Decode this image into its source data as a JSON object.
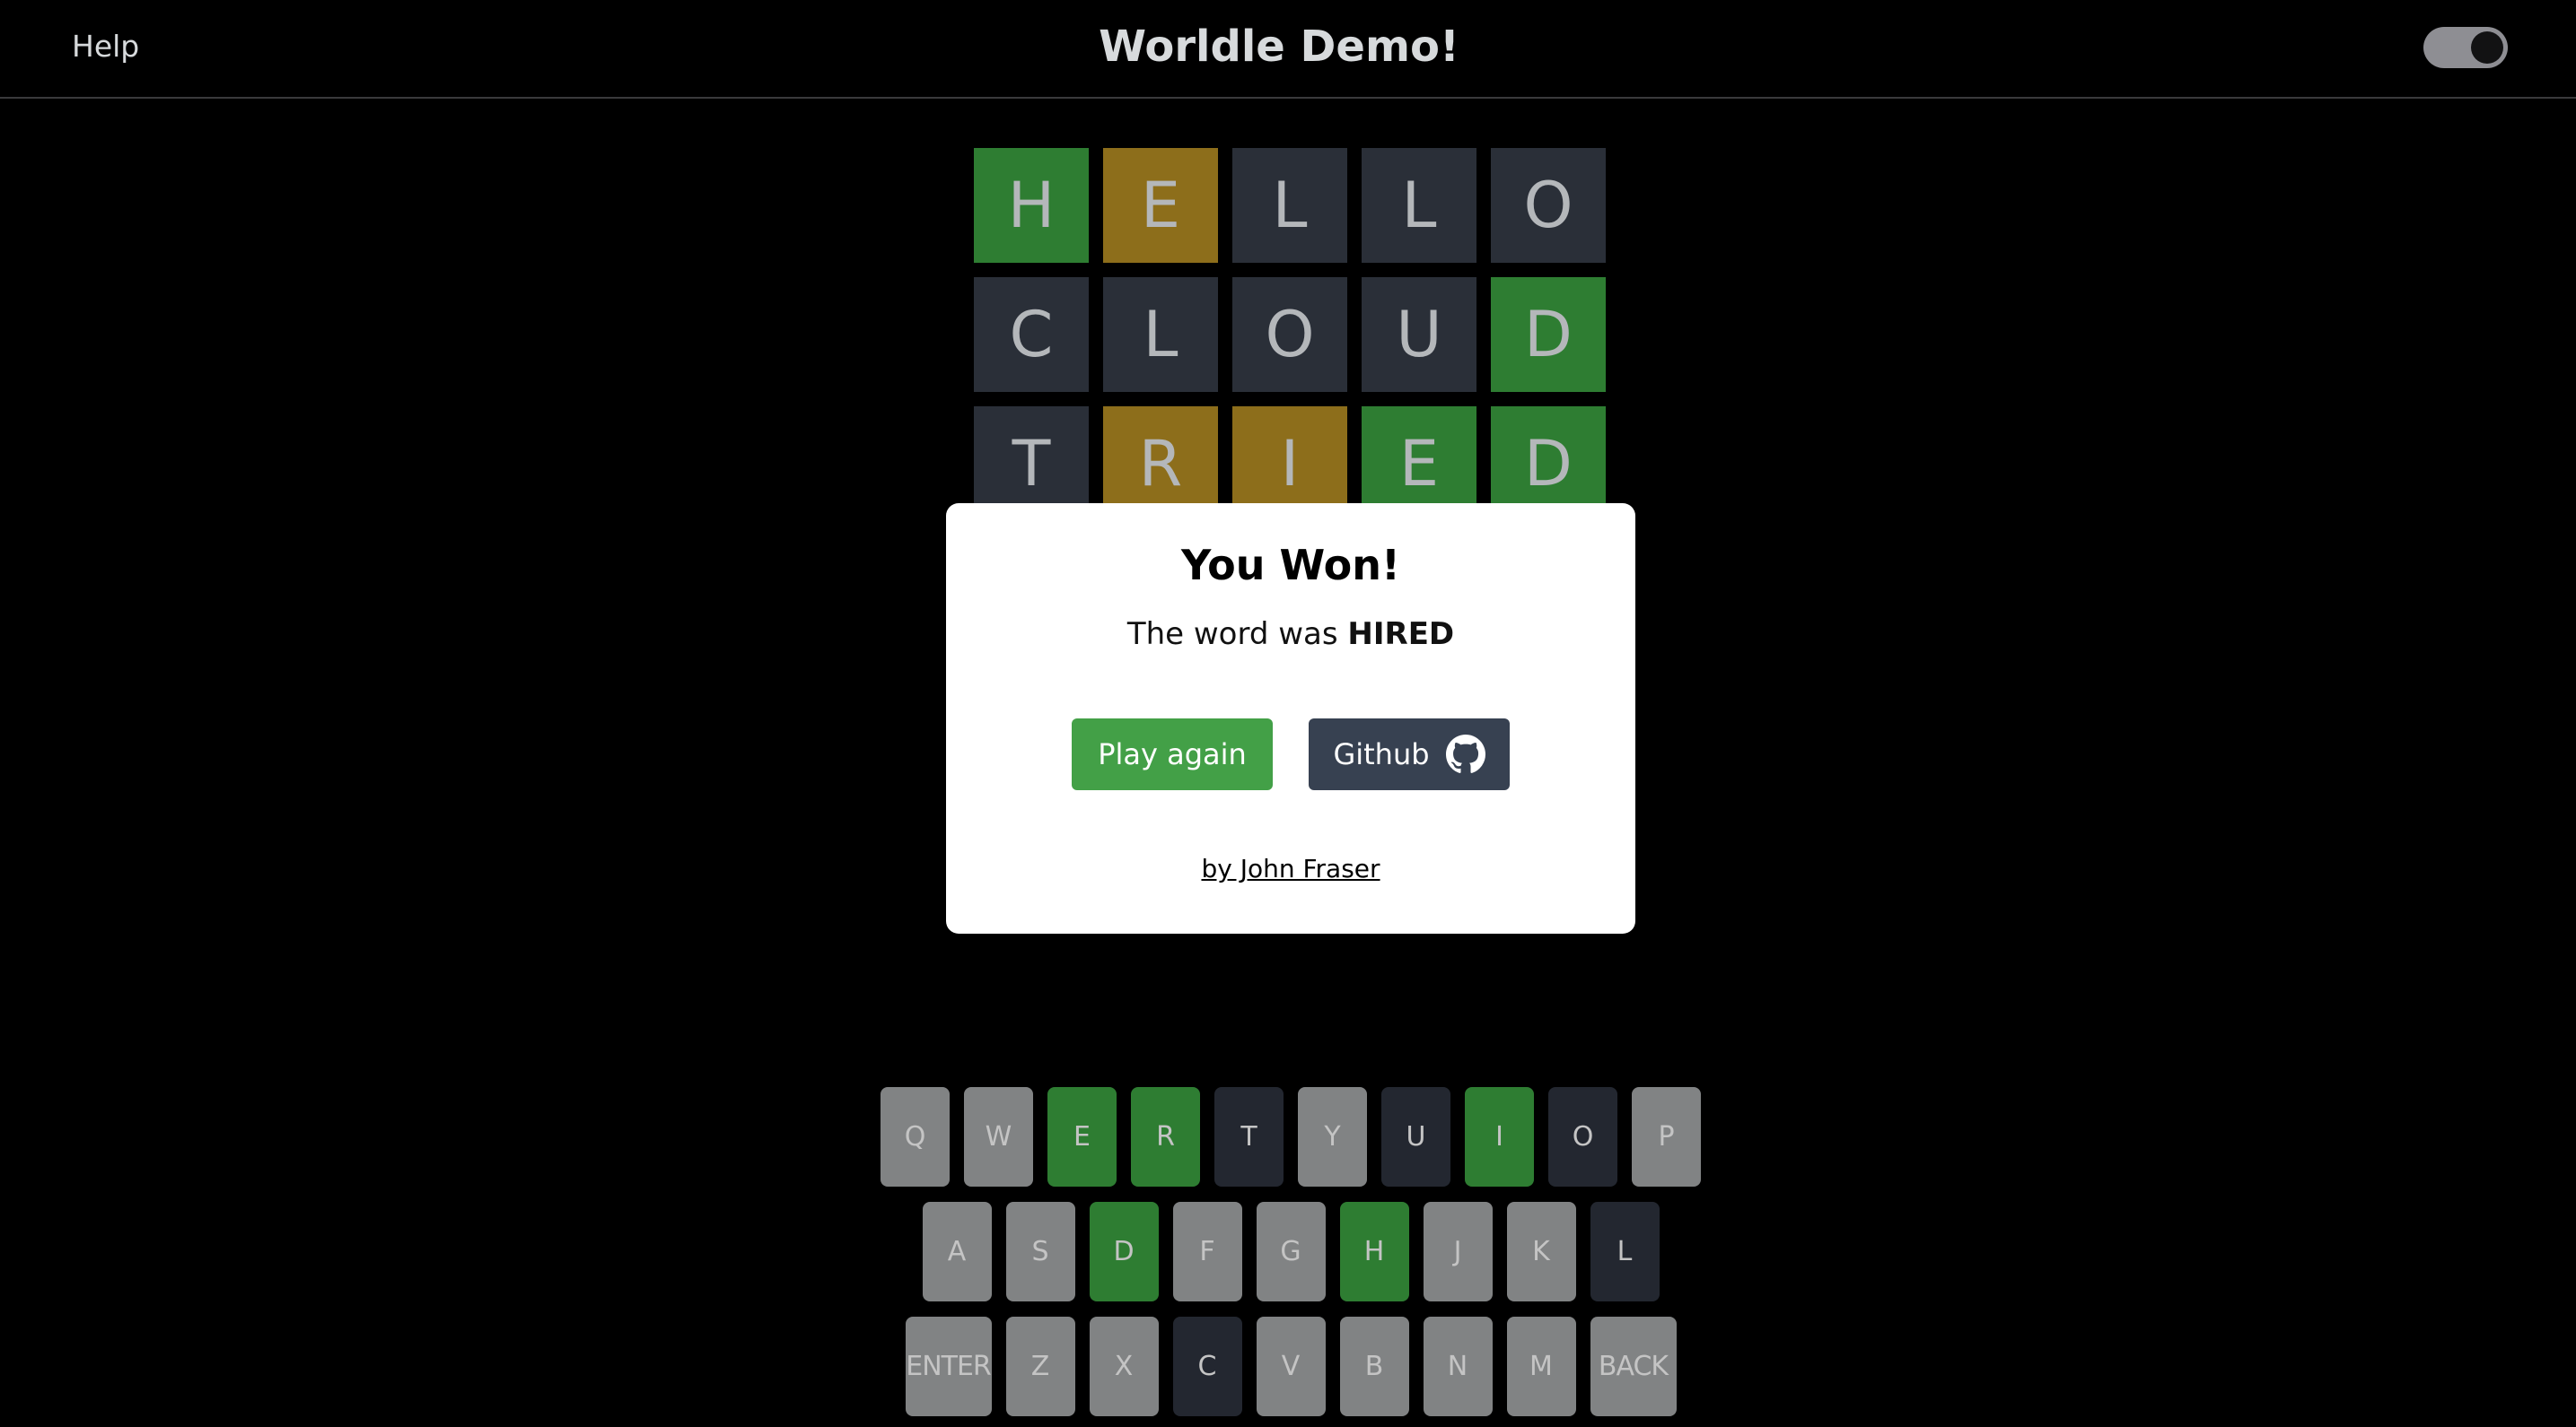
{
  "header": {
    "help_label": "Help",
    "title": "Worldle Demo!",
    "toggle_state": "on"
  },
  "colors": {
    "correct": "#2e7d32",
    "present": "#8d6e1b",
    "absent": "#2a2f38",
    "unused_key": "#818384"
  },
  "board": {
    "rows": [
      [
        {
          "letter": "H",
          "state": "correct"
        },
        {
          "letter": "E",
          "state": "present"
        },
        {
          "letter": "L",
          "state": "absent"
        },
        {
          "letter": "L",
          "state": "absent"
        },
        {
          "letter": "O",
          "state": "absent"
        }
      ],
      [
        {
          "letter": "C",
          "state": "absent"
        },
        {
          "letter": "L",
          "state": "absent"
        },
        {
          "letter": "O",
          "state": "absent"
        },
        {
          "letter": "U",
          "state": "absent"
        },
        {
          "letter": "D",
          "state": "correct"
        }
      ],
      [
        {
          "letter": "T",
          "state": "absent"
        },
        {
          "letter": "R",
          "state": "present"
        },
        {
          "letter": "I",
          "state": "present"
        },
        {
          "letter": "E",
          "state": "correct"
        },
        {
          "letter": "D",
          "state": "correct"
        }
      ]
    ]
  },
  "modal": {
    "title": "You Won!",
    "message_prefix": "The word was ",
    "solution": "HIRED",
    "play_again_label": "Play again",
    "github_label": "Github",
    "github_icon": "github-icon",
    "author_label": "by John Fraser"
  },
  "keyboard": {
    "rows": [
      [
        {
          "label": "Q",
          "state": "unused"
        },
        {
          "label": "W",
          "state": "unused"
        },
        {
          "label": "E",
          "state": "correct"
        },
        {
          "label": "R",
          "state": "correct"
        },
        {
          "label": "T",
          "state": "absent"
        },
        {
          "label": "Y",
          "state": "unused"
        },
        {
          "label": "U",
          "state": "absent"
        },
        {
          "label": "I",
          "state": "correct"
        },
        {
          "label": "O",
          "state": "absent"
        },
        {
          "label": "P",
          "state": "unused"
        }
      ],
      [
        {
          "label": "A",
          "state": "unused"
        },
        {
          "label": "S",
          "state": "unused"
        },
        {
          "label": "D",
          "state": "correct"
        },
        {
          "label": "F",
          "state": "unused"
        },
        {
          "label": "G",
          "state": "unused"
        },
        {
          "label": "H",
          "state": "correct"
        },
        {
          "label": "J",
          "state": "unused"
        },
        {
          "label": "K",
          "state": "unused"
        },
        {
          "label": "L",
          "state": "absent"
        }
      ],
      [
        {
          "label": "ENTER",
          "state": "unused",
          "wide": true
        },
        {
          "label": "Z",
          "state": "unused"
        },
        {
          "label": "X",
          "state": "unused"
        },
        {
          "label": "C",
          "state": "absent"
        },
        {
          "label": "V",
          "state": "unused"
        },
        {
          "label": "B",
          "state": "unused"
        },
        {
          "label": "N",
          "state": "unused"
        },
        {
          "label": "M",
          "state": "unused"
        },
        {
          "label": "BACK",
          "state": "unused",
          "wide": true
        }
      ]
    ]
  }
}
